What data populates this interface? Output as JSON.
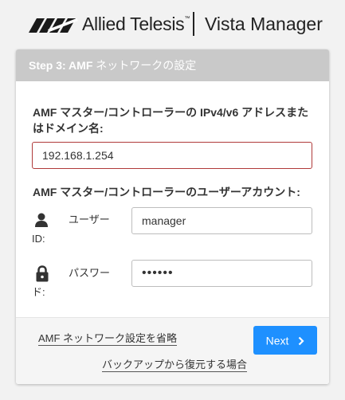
{
  "brand": {
    "name": "Allied Telesis",
    "trademark": "™",
    "product": "Vista Manager",
    "logo_icon": "allied-telesis-logo-mark"
  },
  "card": {
    "header": {
      "step": "Step 3: AMF",
      "title": " ネットワークの設定"
    },
    "address_label": "AMF マスター/コントローラーの IPv4/v6 アドレスまたはドメイン名:",
    "address_value": "192.168.1.254",
    "account_label": "AMF マスター/コントローラーのユーザーアカウント:",
    "user": {
      "label_line1": "ユーザー",
      "label_line2": "ID:",
      "value": "manager",
      "icon": "person-icon"
    },
    "password": {
      "label_line1": "パスワー",
      "label_line2": "ド:",
      "value": "••••••",
      "icon": "lock-icon"
    },
    "footer": {
      "skip_link": "AMF ネットワーク設定を省略",
      "restore_link": "バックアップから復元する場合",
      "next_label": "Next"
    }
  },
  "colors": {
    "header_bg": "#c9c9c9",
    "primary_button": "#1e90ff",
    "error_border": "#b03a3a",
    "background": "#f2f2f2"
  }
}
